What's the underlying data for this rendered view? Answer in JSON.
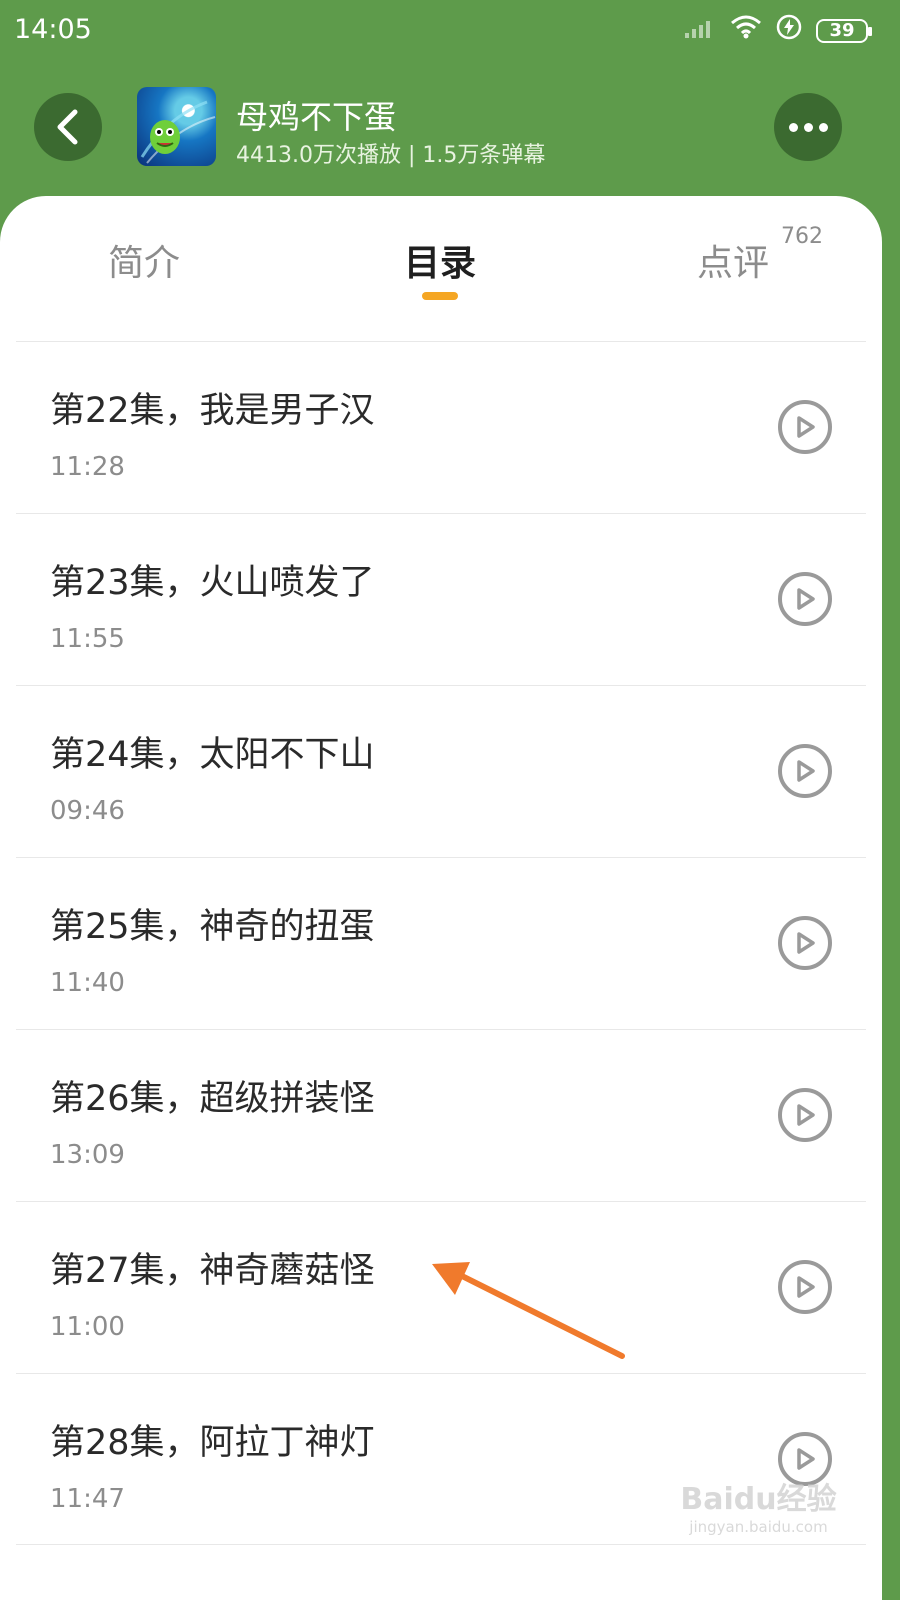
{
  "status_bar": {
    "time": "14:05",
    "battery": "39"
  },
  "header": {
    "title": "母鸡不下蛋",
    "subtitle": "4413.0万次播放 | 1.5万条弹幕"
  },
  "tabs": [
    {
      "label": "简介"
    },
    {
      "label": "目录"
    },
    {
      "label": "点评",
      "badge": "762"
    }
  ],
  "episodes": [
    {
      "title": "第22集，我是男子汉",
      "duration": "11:28"
    },
    {
      "title": "第23集，火山喷发了",
      "duration": "11:55"
    },
    {
      "title": "第24集，太阳不下山",
      "duration": "09:46"
    },
    {
      "title": "第25集，神奇的扭蛋",
      "duration": "11:40"
    },
    {
      "title": "第26集，超级拼装怪",
      "duration": "13:09"
    },
    {
      "title": "第27集，神奇蘑菇怪",
      "duration": "11:00"
    },
    {
      "title": "第28集，阿拉丁神灯",
      "duration": "11:47"
    }
  ],
  "watermark": {
    "logo": "Baidu经验",
    "url": "jingyan.baidu.com"
  },
  "colors": {
    "header_green": "#5e9b4b",
    "button_dark_green": "#3b6a30",
    "tab_indicator": "#f5a623",
    "annotation_arrow": "#f07a2c"
  }
}
